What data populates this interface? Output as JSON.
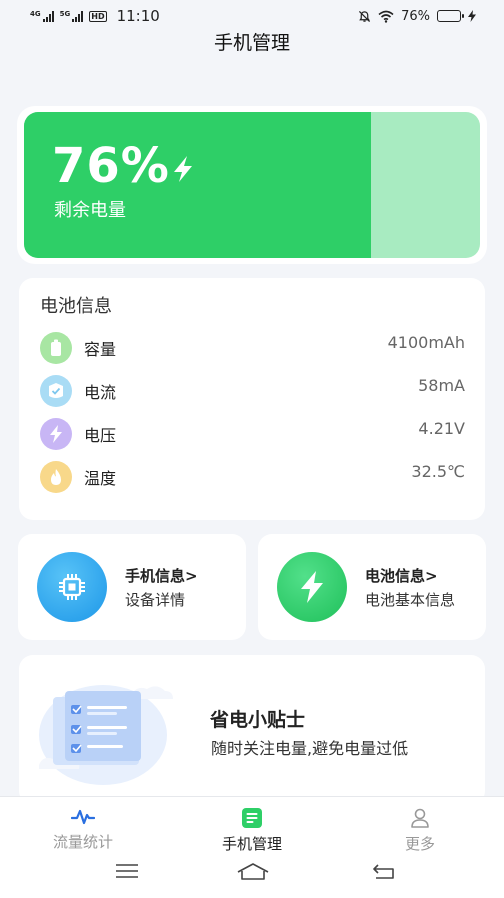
{
  "status_bar": {
    "net1": "4G",
    "net2": "5G",
    "hd": "HD",
    "time": "11:10",
    "battery_text": "76%",
    "battery_level": 0.76
  },
  "header": {
    "title": "手机管理"
  },
  "battery": {
    "percent_text": "76%",
    "label": "剩余电量",
    "level": 0.76,
    "fill_color": "#2ecf67",
    "track_color": "#a8ebc1"
  },
  "battery_info": {
    "title": "电池信息",
    "rows": [
      {
        "label": "容量",
        "value": "4100mAh",
        "icon": "battery-capacity-icon",
        "color": "#a8e6a3"
      },
      {
        "label": "电流",
        "value": "58mA",
        "icon": "current-icon",
        "color": "#a9dcf5"
      },
      {
        "label": "电压",
        "value": "4.21V",
        "icon": "voltage-icon",
        "color": "#c8b6f5"
      },
      {
        "label": "温度",
        "value": "32.5℃",
        "icon": "temperature-icon",
        "color": "#f8d88a"
      }
    ]
  },
  "cards": {
    "phone_info": {
      "title": "手机信息>",
      "subtitle": "设备详情",
      "icon": "chip-icon",
      "color": "#27a4ee"
    },
    "battery_info": {
      "title": "电池信息>",
      "subtitle": "电池基本信息",
      "icon": "lightning-icon",
      "color": "#2ecf67"
    }
  },
  "tips": {
    "title": "省电小贴士",
    "subtitle": "随时关注电量,避免电量过低",
    "icon": "checklist-illustration"
  },
  "bottom_nav": {
    "items": [
      {
        "label": "流量统计",
        "icon": "pulse-icon",
        "active": false
      },
      {
        "label": "手机管理",
        "icon": "document-icon",
        "active": true
      },
      {
        "label": "更多",
        "icon": "user-icon",
        "active": false
      }
    ]
  },
  "system_nav": {
    "icons": [
      "menu-icon",
      "home-icon",
      "back-icon"
    ]
  }
}
